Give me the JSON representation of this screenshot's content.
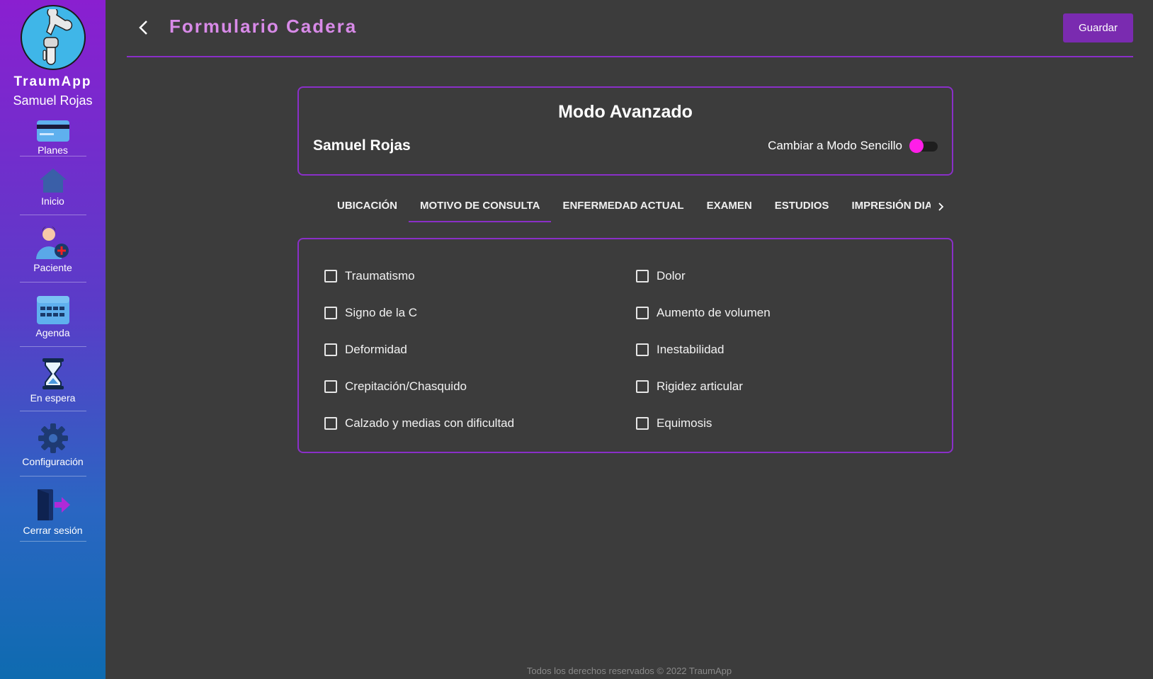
{
  "sidebar": {
    "brand": "TraumApp",
    "user_name": "Samuel Rojas",
    "items": [
      {
        "label": "Planes",
        "icon": "credit-card-icon"
      },
      {
        "label": "Inicio",
        "icon": "home-icon"
      },
      {
        "label": "Paciente",
        "icon": "add-patient-icon"
      },
      {
        "label": "Agenda",
        "icon": "calendar-icon"
      },
      {
        "label": "En espera",
        "icon": "hourglass-icon"
      },
      {
        "label": "Configuración",
        "icon": "gear-icon"
      },
      {
        "label": "Cerrar sesión",
        "icon": "logout-door-icon"
      }
    ]
  },
  "header": {
    "title": "Formulario Cadera",
    "save_label": "Guardar"
  },
  "mode_card": {
    "title": "Modo Avanzado",
    "patient_name": "Samuel Rojas",
    "toggle_label": "Cambiar a Modo Sencillo",
    "toggle_on": false
  },
  "tabs": [
    {
      "label": "UBICACIÓN",
      "active": false
    },
    {
      "label": "MOTIVO DE CONSULTA",
      "active": true
    },
    {
      "label": "ENFERMEDAD ACTUAL",
      "active": false
    },
    {
      "label": "EXAMEN",
      "active": false
    },
    {
      "label": "ESTUDIOS",
      "active": false
    },
    {
      "label": "IMPRESIÓN DIAGNÓSTICA",
      "active": false
    }
  ],
  "checklist": {
    "left": [
      "Traumatismo",
      "Signo de la C",
      "Deformidad",
      "Crepitación/Chasquido",
      "Calzado y medias con dificultad"
    ],
    "right": [
      "Dolor",
      "Aumento de volumen",
      "Inestabilidad",
      "Rigidez articular",
      "Equimosis"
    ]
  },
  "footer": "Todos los derechos reservados © 2022 TraumApp",
  "colors": {
    "accent": "#8a2fc8",
    "title": "#d88ae8",
    "toggle": "#ff1ee8",
    "background": "#3c3c3c"
  }
}
